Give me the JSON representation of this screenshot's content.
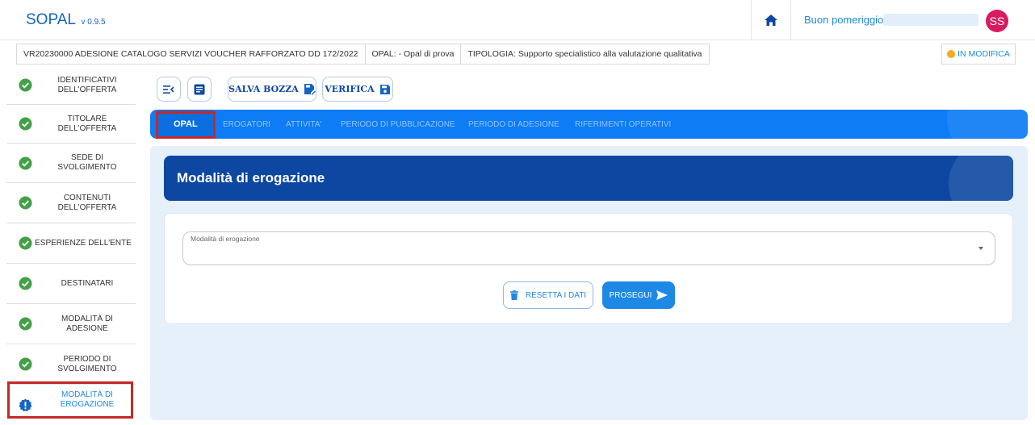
{
  "header": {
    "app_name": "SOPAL",
    "version": "v 0.9.5",
    "greeting": "Buon pomeriggio",
    "avatar_initials": "SS",
    "home_icon": "home-icon"
  },
  "info_bar": {
    "offer_code": "VR20230000 ADESIONE CATALOGO SERVIZI VOUCHER RAFFORZATO DD 172/2022",
    "opal": "OPAL: - Opal di prova",
    "tipologia": "TIPOLOGIA: Supporto specialistico alla valutazione qualitativa",
    "status": "IN MODIFICA",
    "status_color": "#f9a825"
  },
  "sidebar": {
    "items": [
      {
        "label_1": "IDENTIFICATIVI",
        "label_2": "DELL'OFFERTA",
        "state": "complete"
      },
      {
        "label_1": "TITOLARE",
        "label_2": "DELL'OFFERTA",
        "state": "complete"
      },
      {
        "label_1": "SEDE DI",
        "label_2": "SVOLGIMENTO",
        "state": "complete"
      },
      {
        "label_1": "CONTENUTI",
        "label_2": "DELL'OFFERTA",
        "state": "complete"
      },
      {
        "label_1": "ESPERIENZE DELL'ENTE",
        "label_2": "",
        "state": "complete"
      },
      {
        "label_1": "DESTINATARI",
        "label_2": "",
        "state": "complete"
      },
      {
        "label_1": "MODALITÀ DI",
        "label_2": "ADESIONE",
        "state": "complete"
      },
      {
        "label_1": "PERIODO DI",
        "label_2": "SVOLGIMENTO",
        "state": "complete"
      },
      {
        "label_1": "MODALITÀ DI",
        "label_2": "EROGAZIONE",
        "state": "active"
      }
    ],
    "complete_color": "#43a047",
    "active_color": "#1e88e5"
  },
  "toolbar": {
    "save_draft_label": "SALVA BOZZA",
    "verify_label": "VERIFICA"
  },
  "tabs": [
    {
      "label": "OPAL",
      "active": true
    },
    {
      "label": "EROGATORI",
      "active": false
    },
    {
      "label": "ATTIVITA'",
      "active": false
    },
    {
      "label": "PERIODO DI PUBBLICAZIONE",
      "active": false
    },
    {
      "label": "PERIODO DI ADESIONE",
      "active": false
    },
    {
      "label": "RIFERIMENTI OPERATIVI",
      "active": false
    }
  ],
  "main": {
    "section_title": "Modalità di erogazione",
    "field_label": "Modalità di erogazione",
    "field_value": "",
    "reset_label": "RESETTA I DATI",
    "next_label": "PROSEGUI"
  }
}
